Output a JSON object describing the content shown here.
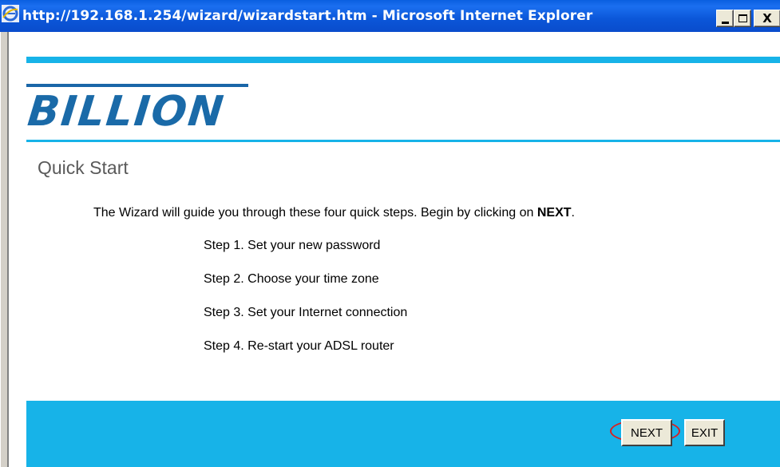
{
  "window": {
    "title": "http://192.168.1.254/wizard/wizardstart.htm - Microsoft Internet Explorer",
    "minimize_label": "_",
    "close_label": "X"
  },
  "logo": {
    "text": "BILLION"
  },
  "page": {
    "title": "Quick Start",
    "intro_prefix": "The Wizard will guide you through these four quick steps. Begin by clicking on ",
    "intro_bold": "NEXT",
    "intro_suffix": ".",
    "steps": [
      "Step 1. Set your new password",
      "Step 2. Choose your time zone",
      "Step 3. Set your Internet connection",
      "Step 4. Re-start your ADSL router"
    ]
  },
  "buttons": {
    "next": "NEXT",
    "exit": "EXIT"
  },
  "colors": {
    "title_bar": "#0a5fe0",
    "accent_stripe": "#17b3e8",
    "logo": "#1a6aa8",
    "highlight": "#d92020"
  },
  "icons": {
    "browser": "internet-explorer-icon"
  }
}
